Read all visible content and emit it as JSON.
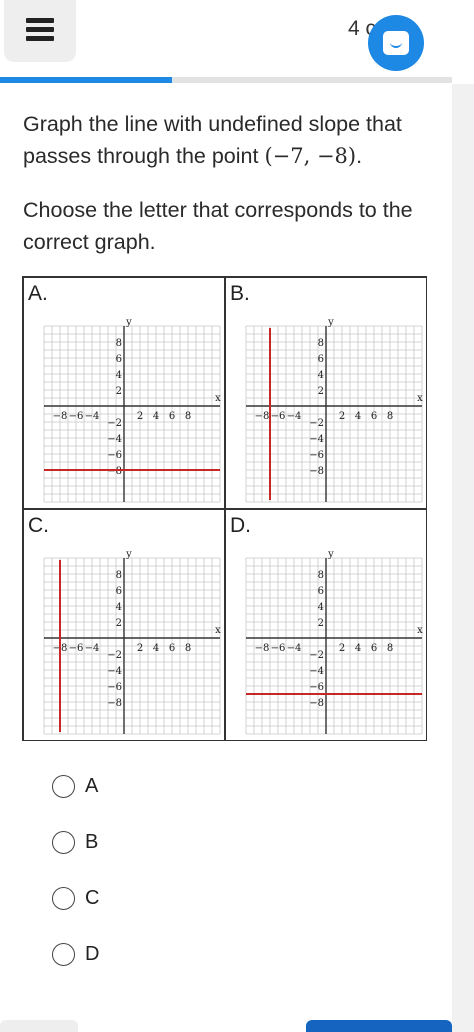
{
  "header": {
    "counter_text": "4 c",
    "progress_fraction": 0.38,
    "accent_color": "#1e88e5",
    "menu_icon": "hamburger-icon",
    "chat_icon": "chat-bubble-icon"
  },
  "question": {
    "text_before": "Graph the line with undefined slope that passes through the point ",
    "point": "(−7, −8)",
    "text_after": ".",
    "instruction": "Choose the letter that corresponds to the correct graph."
  },
  "graphs": [
    {
      "label": "A.",
      "line": "horizontal",
      "at": -8
    },
    {
      "label": "B.",
      "line": "vertical",
      "at": -7
    },
    {
      "label": "C.",
      "line": "vertical",
      "at": -8
    },
    {
      "label": "D.",
      "line": "horizontal",
      "at": -7
    }
  ],
  "axis": {
    "x_label": "x",
    "y_label": "y",
    "x_ticks": [
      "−8",
      "−6",
      "−4",
      "2",
      "4",
      "6",
      "8"
    ],
    "y_ticks": [
      "8",
      "6",
      "4",
      "2",
      "−2",
      "−4",
      "−6",
      "−8"
    ],
    "line_color": "#c62828"
  },
  "options": [
    {
      "label": "A"
    },
    {
      "label": "B"
    },
    {
      "label": "C"
    },
    {
      "label": "D"
    }
  ]
}
